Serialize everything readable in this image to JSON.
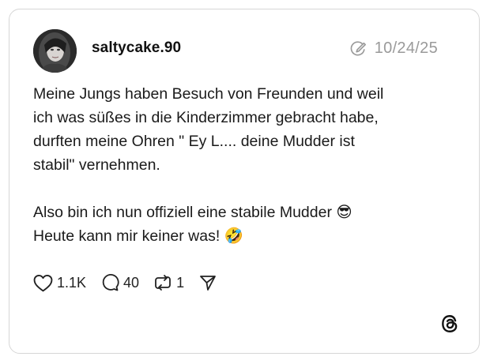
{
  "post": {
    "username": "saltycake.90",
    "date": "10/24/25",
    "text": "Meine Jungs haben Besuch von Freunden und weil\nich was süßes in die Kinderzimmer gebracht habe,\ndurften meine Ohren \" Ey L.... deine Mudder ist\nstabil\" vernehmen.\n\nAlso bin ich nun offiziell eine stabile Mudder 😎\nHeute kann mir keiner was! 🤣",
    "stats": {
      "likes": "1.1K",
      "comments": "40",
      "reposts": "1"
    }
  },
  "icons": {
    "edited": "edit-pencil-icon",
    "like": "heart-icon",
    "comment": "speech-bubble-icon",
    "repost": "repost-icon",
    "share": "send-icon",
    "brand": "threads-logo-icon"
  },
  "colors": {
    "muted": "#9a9a9a",
    "border": "#d6d6d6",
    "text": "#1a1a1a"
  }
}
